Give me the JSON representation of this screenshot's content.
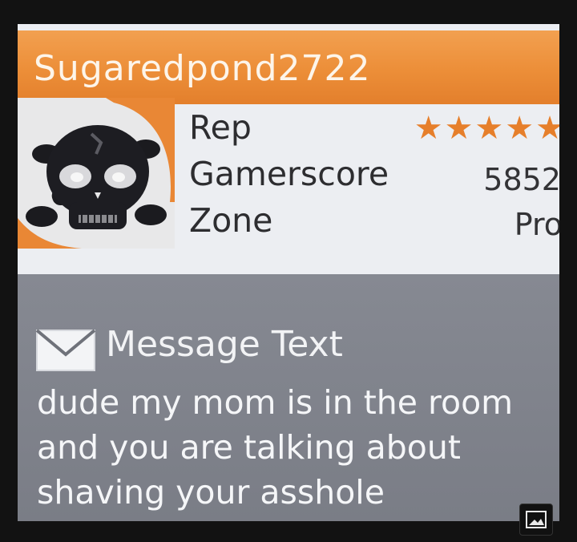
{
  "gamercard": {
    "gamertag": "Sugaredpond2722",
    "labels": {
      "rep": "Rep",
      "gamerscore": "Gamerscore",
      "zone": "Zone"
    },
    "values": {
      "rep_stars": "★★★★★",
      "gamerscore": "5852",
      "zone": "Pro"
    },
    "avatar_icon": "skull-icon"
  },
  "message": {
    "title": "Message Text",
    "lines": [
      "dude my mom is in the room",
      "and you are talking about",
      "shaving your asshole"
    ],
    "icon": "envelope-icon"
  },
  "overlay": {
    "icon": "image-view-icon"
  },
  "colors": {
    "accent_orange": "#e8873a",
    "panel_gray": "#7d8088",
    "card_bg": "#eceef2"
  }
}
